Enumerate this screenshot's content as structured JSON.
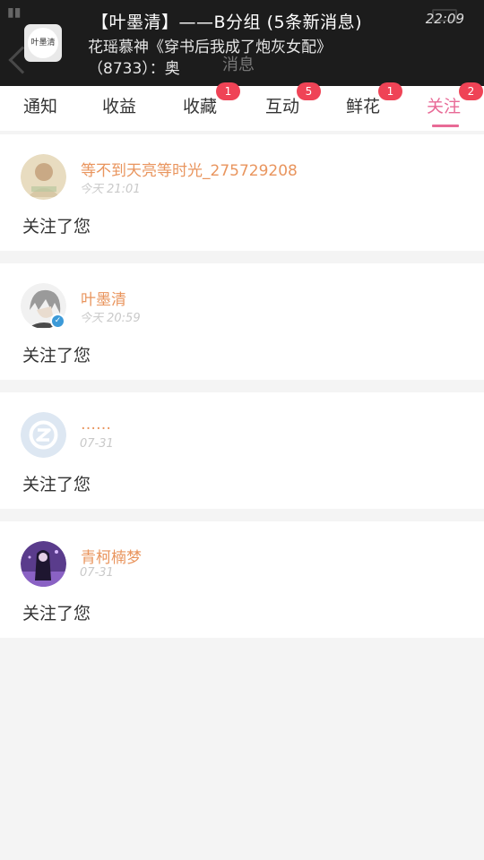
{
  "notification": {
    "title": "【叶墨清】——B分组 (5条新消息)",
    "time": "22:09",
    "line1": "花瑶慕神《穿书后我成了炮灰女配》",
    "line2": "（8733）：奥",
    "app_icon_text": "叶墨清"
  },
  "underlying_header": {
    "title": "消息"
  },
  "tabs": [
    {
      "label": "通知",
      "badge": ""
    },
    {
      "label": "收益",
      "badge": ""
    },
    {
      "label": "收藏",
      "badge": "1"
    },
    {
      "label": "互动",
      "badge": "5"
    },
    {
      "label": "鲜花",
      "badge": "1"
    },
    {
      "label": "关注",
      "badge": "2"
    }
  ],
  "active_tab": "关注",
  "items": [
    {
      "name": "等不到天亮等时光_275729208",
      "time": "今天 21:01",
      "action": "关注了您",
      "verified": false
    },
    {
      "name": "叶墨清",
      "time": "今天 20:59",
      "action": "关注了您",
      "verified": true
    },
    {
      "name": "……",
      "time": "07-31",
      "action": "关注了您",
      "verified": false
    },
    {
      "name": "青柯楠梦",
      "time": "07-31",
      "action": "关注了您",
      "verified": false
    }
  ],
  "colors": {
    "accent": "#e86a96",
    "badge": "#ef4356",
    "username": "#e9955e",
    "verified": "#3c9ad8"
  }
}
